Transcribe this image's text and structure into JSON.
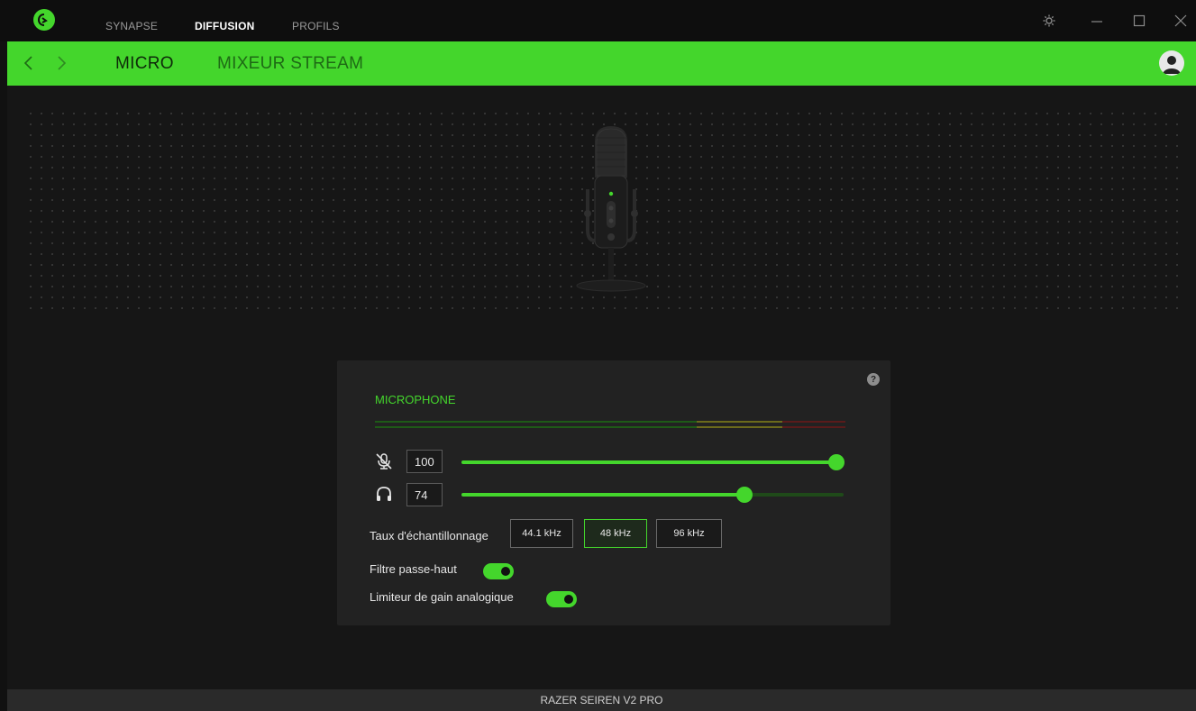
{
  "nav": {
    "tabs": [
      {
        "label": "SYNAPSE",
        "active": false
      },
      {
        "label": "DIFFUSION",
        "active": true
      },
      {
        "label": "PROFILS",
        "active": false
      }
    ]
  },
  "subnav": {
    "tabs": [
      {
        "label": "MICRO",
        "active": true
      },
      {
        "label": "MIXEUR STREAM",
        "active": false
      }
    ]
  },
  "panel": {
    "title": "MICROPHONE",
    "help_label": "?",
    "mic_volume": 100,
    "monitor_volume": 74,
    "sample_rate": {
      "label": "Taux d'échantillonnage",
      "options": [
        "44.1 kHz",
        "48 kHz",
        "96 kHz"
      ],
      "selected": "48 kHz"
    },
    "high_pass_filter": {
      "label": "Filtre passe-haut",
      "enabled": true
    },
    "analog_gain_limiter": {
      "label": "Limiteur de gain analogique",
      "enabled": true
    }
  },
  "footer": {
    "device_name": "RAZER SEIREN V2 PRO"
  },
  "colors": {
    "accent": "#44d62c",
    "background": "#111111",
    "panel": "#222222"
  },
  "icons": [
    "razer-logo-icon",
    "back-arrow-icon",
    "forward-arrow-icon",
    "settings-icon",
    "minimize-icon",
    "maximize-icon",
    "close-icon",
    "user-avatar-icon",
    "help-icon",
    "mic-mute-icon",
    "headphones-icon"
  ]
}
